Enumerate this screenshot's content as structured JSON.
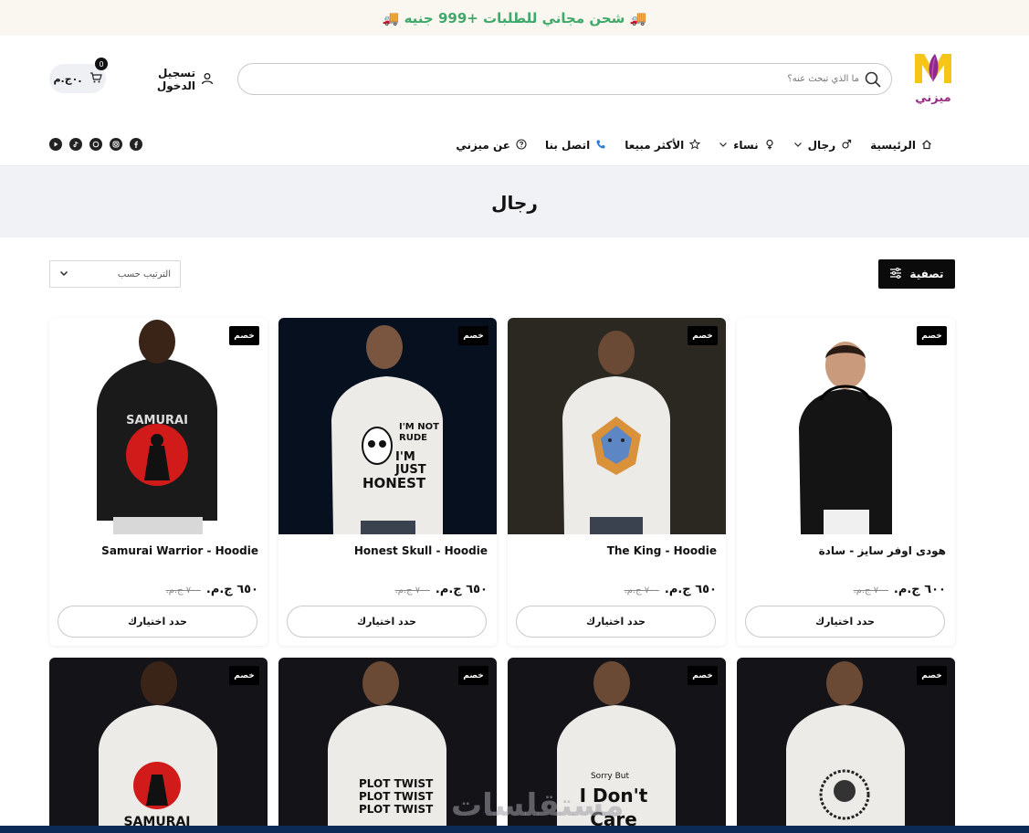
{
  "topbar": {
    "text": "🚚 شحن مجاني للطلبات +999 جنيه 🚚"
  },
  "header": {
    "logo_text": "ميزني",
    "search_placeholder": "ما الذي تبحث عنه؟",
    "login_label": "تسجيل الدخول",
    "cart_total": "٠ج.م.",
    "cart_count": "0"
  },
  "nav": {
    "items": [
      {
        "label": "الرئيسية",
        "icon": "home-icon"
      },
      {
        "label": "رجال",
        "icon": "male-icon",
        "dropdown": true
      },
      {
        "label": "نساء",
        "icon": "female-icon",
        "dropdown": true
      },
      {
        "label": "الأكثر مبيعا",
        "icon": "star-icon"
      },
      {
        "label": "اتصل بنا",
        "icon": "phone-icon"
      },
      {
        "label": "عن ميزني",
        "icon": "help-icon"
      }
    ],
    "active": "رجال"
  },
  "social": [
    "facebook-icon",
    "instagram-icon",
    "whatsapp-icon",
    "tiktok-icon",
    "youtube-icon"
  ],
  "page_title": "رجال",
  "toolbar": {
    "filter_label": "تصفية",
    "sort_label": "الترتيب حسب"
  },
  "products": [
    {
      "title": "هودى اوفر سايز - سادة",
      "price": "٦٠٠ ج.م.",
      "old_price": "٧٠٠ ج.م.",
      "tag": "خصم",
      "button": "حدد اختيارك",
      "bg": "#ffffff",
      "hoodie": "#151515",
      "print": ""
    },
    {
      "title": "The King - Hoodie",
      "price": "٦٥٠ ج.م.",
      "old_price": "٧٠٠ ج.م.",
      "tag": "خصم",
      "button": "حدد اختيارك",
      "bg": "#2b2822",
      "hoodie": "#ecebe7",
      "print": "lion"
    },
    {
      "title": "Honest Skull - Hoodie",
      "price": "٦٥٠ ج.م.",
      "old_price": "٧٠٠ ج.م.",
      "tag": "خصم",
      "button": "حدد اختيارك",
      "bg": "#06101f",
      "hoodie": "#ecebe7",
      "print": "I'M NOT RUDE I'M JUST HONEST"
    },
    {
      "title": "Samurai Warrior - Hoodie",
      "price": "٦٥٠ ج.م.",
      "old_price": "٧٠٠ ج.م.",
      "tag": "خصم",
      "button": "حدد اختيارك",
      "bg": "#ffffff",
      "hoodie": "#1a1a1a",
      "print": "SAMURAI"
    }
  ],
  "products_row2": [
    {
      "tag": "خصم",
      "bg": "#141318",
      "print": "astronaut"
    },
    {
      "tag": "خصم",
      "bg": "#141318",
      "print": "Sorry But I Don't Care"
    },
    {
      "tag": "خصم",
      "bg": "#141318",
      "print": "PLOT TWIST"
    },
    {
      "tag": "خصم",
      "bg": "#141318",
      "print": "SAMURAI"
    }
  ],
  "watermark": "مستقلسات"
}
